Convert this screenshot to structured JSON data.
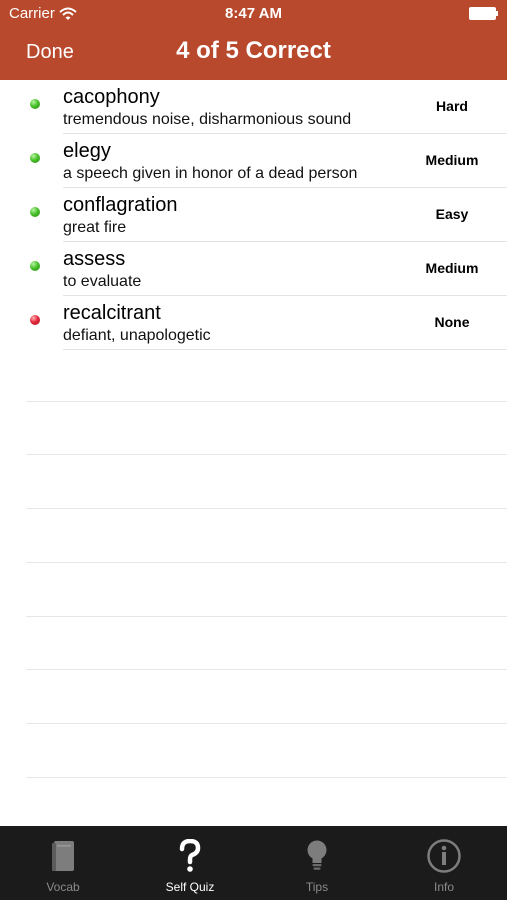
{
  "status_bar": {
    "carrier": "Carrier",
    "time": "8:47 AM",
    "icons": [
      "wifi-icon",
      "battery-icon"
    ]
  },
  "nav": {
    "done_label": "Done",
    "title": "4 of 5 Correct",
    "background_color": "#b9492c"
  },
  "results": [
    {
      "word": "cacophony",
      "definition": "tremendous noise, disharmonious sound",
      "difficulty": "Hard",
      "correct": true
    },
    {
      "word": "elegy",
      "definition": "a speech given in honor of a dead person",
      "difficulty": "Medium",
      "correct": true
    },
    {
      "word": "conflagration",
      "definition": "great fire",
      "difficulty": "Easy",
      "correct": true
    },
    {
      "word": "assess",
      "definition": "to evaluate",
      "difficulty": "Medium",
      "correct": true
    },
    {
      "word": "recalcitrant",
      "definition": "defiant, unapologetic",
      "difficulty": "None",
      "correct": false
    }
  ],
  "status_colors": {
    "correct": "#49c02b",
    "incorrect": "#e6283c"
  },
  "tab_bar": {
    "tabs": [
      {
        "label": "Vocab",
        "icon": "book-icon",
        "active": false
      },
      {
        "label": "Self Quiz",
        "icon": "question-mark-icon",
        "active": true
      },
      {
        "label": "Tips",
        "icon": "lightbulb-icon",
        "active": false
      },
      {
        "label": "Info",
        "icon": "info-icon",
        "active": false
      }
    ]
  }
}
